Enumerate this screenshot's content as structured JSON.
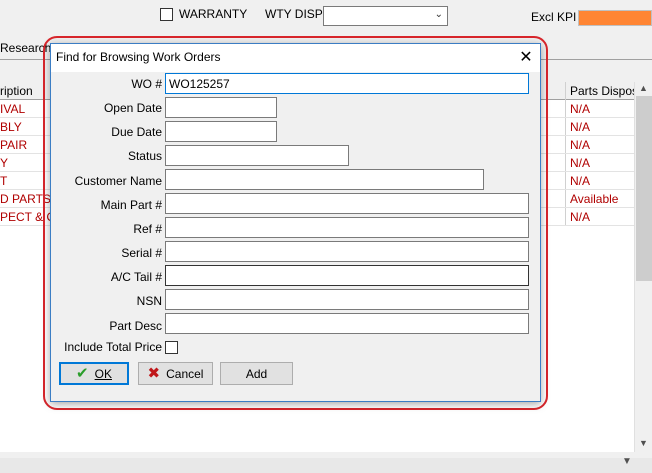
{
  "toolbar": {
    "warranty_label": "WARRANTY",
    "wty_disp_label": "WTY DISP :",
    "wty_disp_value": "",
    "excl_kpi_label": "Excl KPI :",
    "kpi_color": "#ff8533"
  },
  "tabs": {
    "research_label": "Research"
  },
  "grid": {
    "columns": {
      "description": "ription",
      "parts_disposition": "Parts Disposit"
    },
    "rows": [
      {
        "description": "IVAL",
        "parts": "N/A"
      },
      {
        "description": "BLY",
        "parts": "N/A"
      },
      {
        "description": "PAIR",
        "parts": "N/A"
      },
      {
        "description": "Y",
        "parts": "N/A"
      },
      {
        "description": "T",
        "parts": "N/A"
      },
      {
        "description": "D PARTS",
        "parts": "Available"
      },
      {
        "description": "PECT & OE",
        "parts": "N/A"
      }
    ]
  },
  "dialog": {
    "title": "Find for Browsing Work Orders",
    "close_icon": "close-icon",
    "fields": {
      "wo_label": "WO #",
      "wo_value": "WO125257",
      "open_date_label": "Open Date",
      "due_date_label": "Due Date",
      "status_label": "Status",
      "customer_name_label": "Customer Name",
      "main_part_label": "Main Part #",
      "ref_label": "Ref #",
      "serial_label": "Serial #",
      "ac_tail_label": "A/C Tail #",
      "nsn_label": "NSN",
      "part_desc_label": "Part Desc",
      "include_total_price_label": "Include Total Price"
    },
    "buttons": {
      "ok_label": "OK",
      "cancel_label": "Cancel",
      "add_label": "Add"
    },
    "highlight_color": "#d9262c"
  }
}
